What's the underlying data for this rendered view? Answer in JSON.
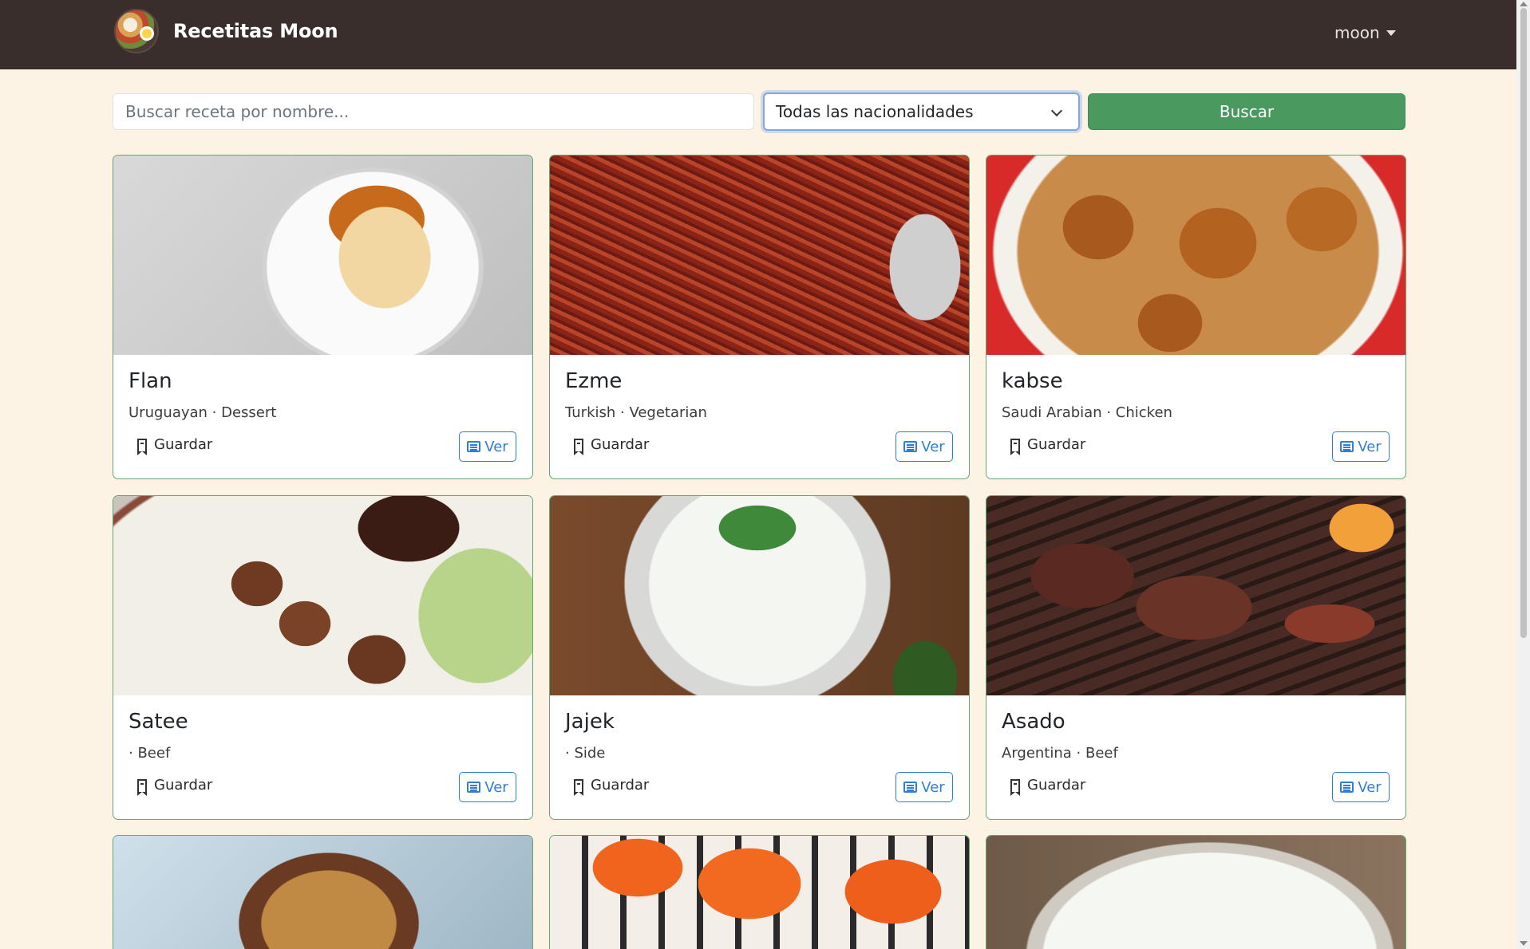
{
  "navbar": {
    "brand": "Recetitas Moon",
    "user": "moon"
  },
  "search": {
    "placeholder": "Buscar receta por nombre...",
    "nationality_selected": "Todas las nacionalidades",
    "button": "Buscar"
  },
  "card_actions": {
    "save": "Guardar",
    "view": "Ver"
  },
  "recipes": [
    {
      "title": "Flan",
      "subtitle": "Uruguayan · Dessert"
    },
    {
      "title": "Ezme",
      "subtitle": "Turkish · Vegetarian"
    },
    {
      "title": "kabse",
      "subtitle": "Saudi Arabian · Chicken"
    },
    {
      "title": "Satee",
      "subtitle": "· Beef"
    },
    {
      "title": "Jajek",
      "subtitle": "· Side"
    },
    {
      "title": "Asado",
      "subtitle": "Argentina · Beef"
    }
  ],
  "colors": {
    "navbar": "#3a2e2c",
    "page_bg": "#fdf3e4",
    "search_button": "#4a9a60",
    "view_button": "#2f7fd6",
    "card_border": "#5fa872"
  },
  "icons": {
    "logo": "food-plate-logo",
    "user_caret": "caret-down-icon",
    "select_chevron": "chevron-down-icon",
    "save": "bookmark-icon",
    "view": "list-icon"
  }
}
